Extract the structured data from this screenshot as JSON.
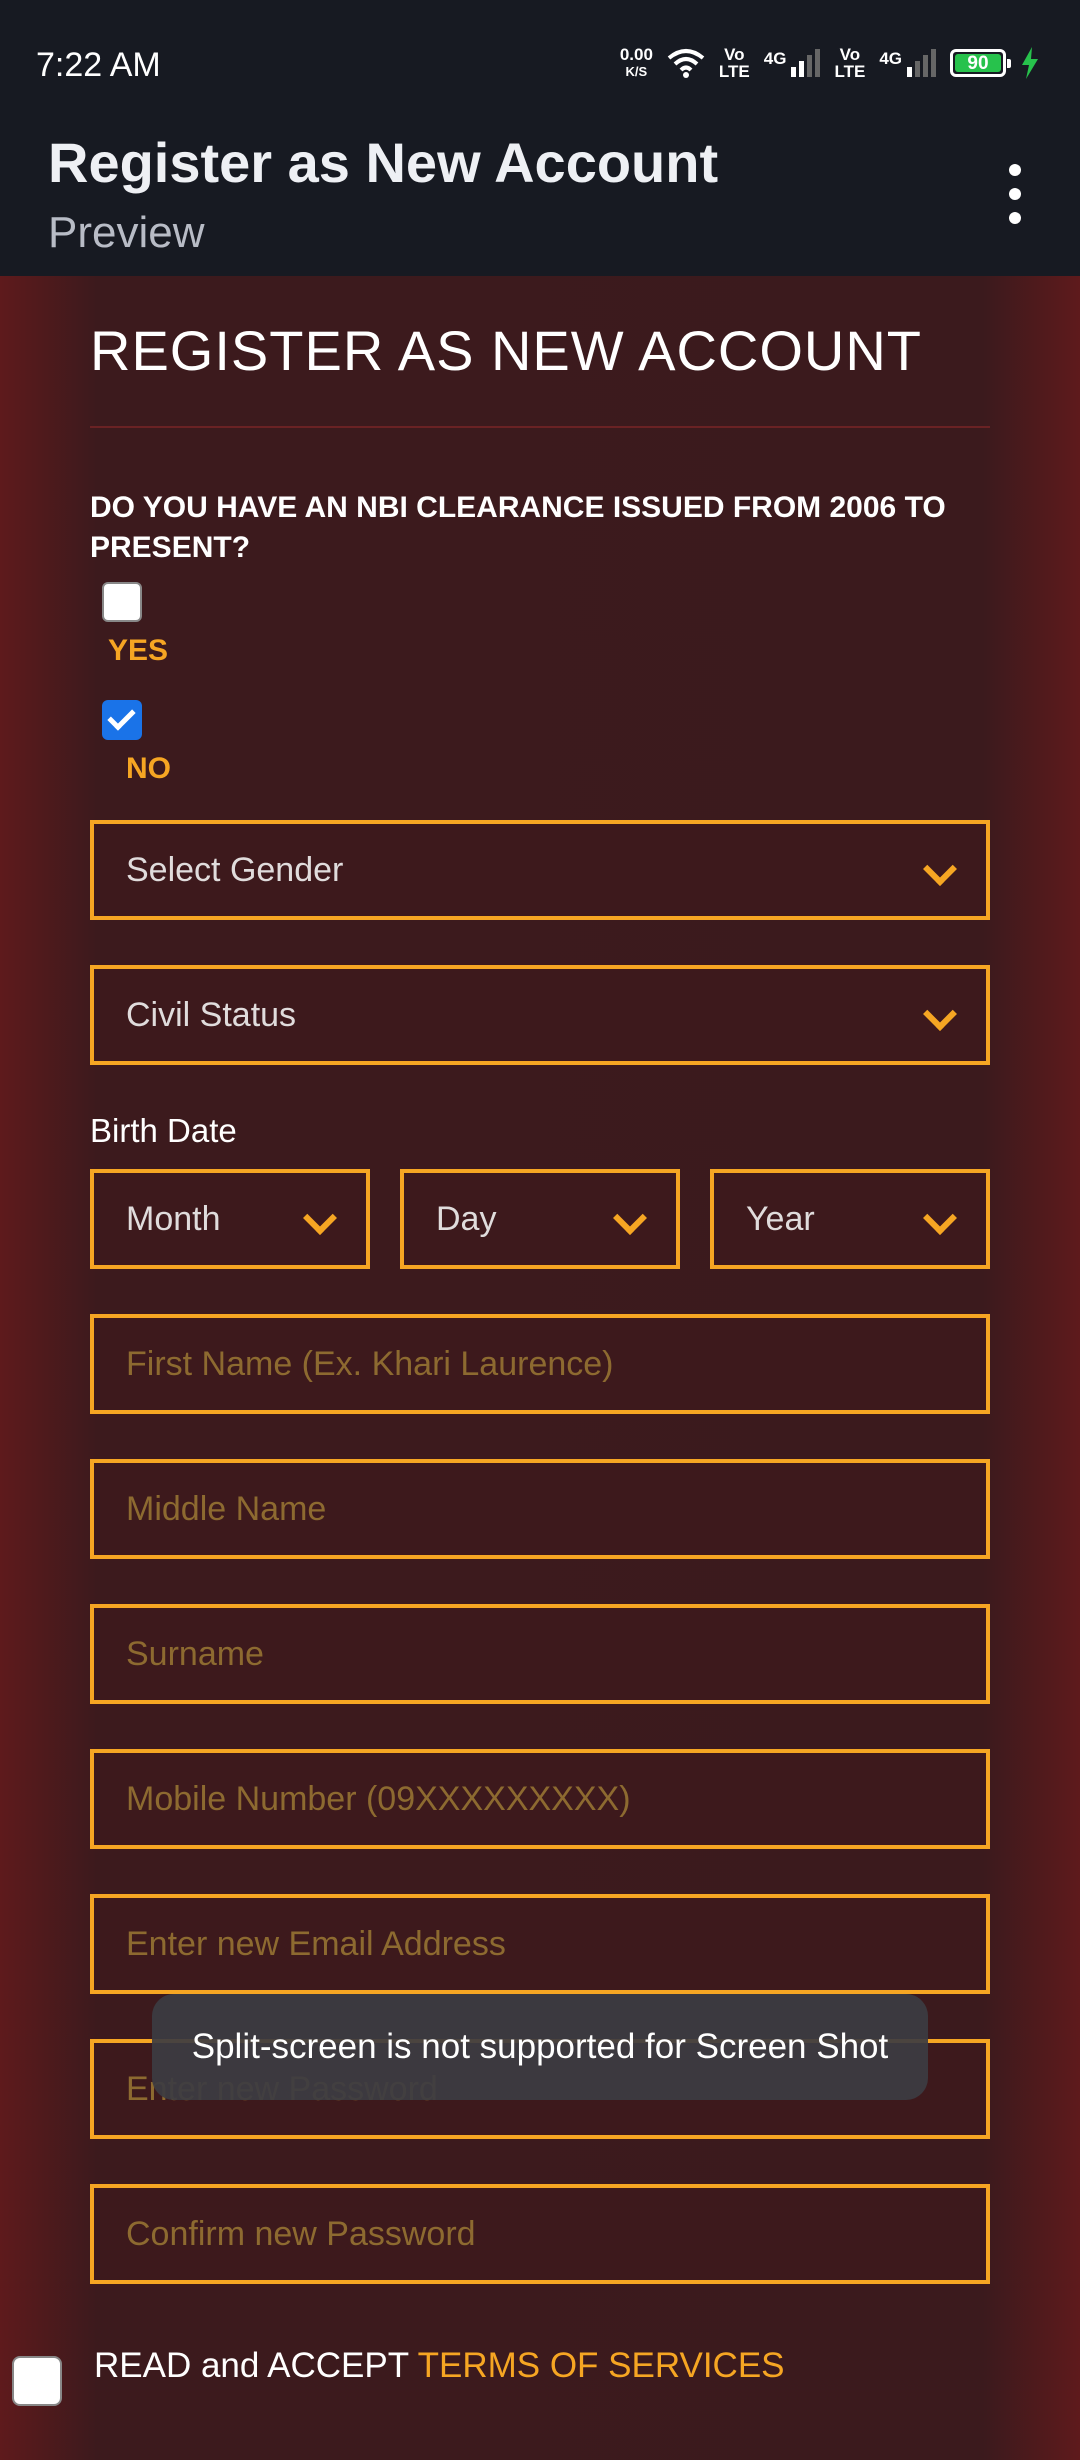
{
  "status_bar": {
    "time": "7:22 AM",
    "net_speed_value": "0.00",
    "net_speed_unit": "K/S",
    "volte_1": [
      "Vo",
      "LTE"
    ],
    "network_1": "4G",
    "volte_2": [
      "Vo",
      "LTE"
    ],
    "network_2": "4G",
    "battery": "90"
  },
  "app_bar": {
    "title": "Register as New Account",
    "subtitle": "Preview"
  },
  "form": {
    "heading": "REGISTER AS NEW ACCOUNT",
    "question": "DO YOU HAVE AN NBI CLEARANCE ISSUED FROM 2006 TO PRESENT?",
    "option_yes": "YES",
    "option_no": "NO",
    "gender_select": "Select Gender",
    "civil_status_select": "Civil Status",
    "birth_date_label": "Birth Date",
    "month_select": "Month",
    "day_select": "Day",
    "year_select": "Year",
    "first_name_placeholder": "First Name (Ex. Khari Laurence)",
    "middle_name_placeholder": "Middle Name",
    "surname_placeholder": "Surname",
    "mobile_placeholder": "Mobile Number (09XXXXXXXXX)",
    "email_placeholder": "Enter new Email Address",
    "password_placeholder": "Enter new Password",
    "confirm_password_placeholder": "Confirm new Password",
    "terms_prefix": "READ and ACCEPT ",
    "terms_link": "TERMS OF SERVICES"
  },
  "toast": "Split-screen is not supported for Screen Shot",
  "colors": {
    "accent": "#f6a623",
    "background": "#3b1a1d",
    "checkbox_checked": "#1a73e8"
  }
}
